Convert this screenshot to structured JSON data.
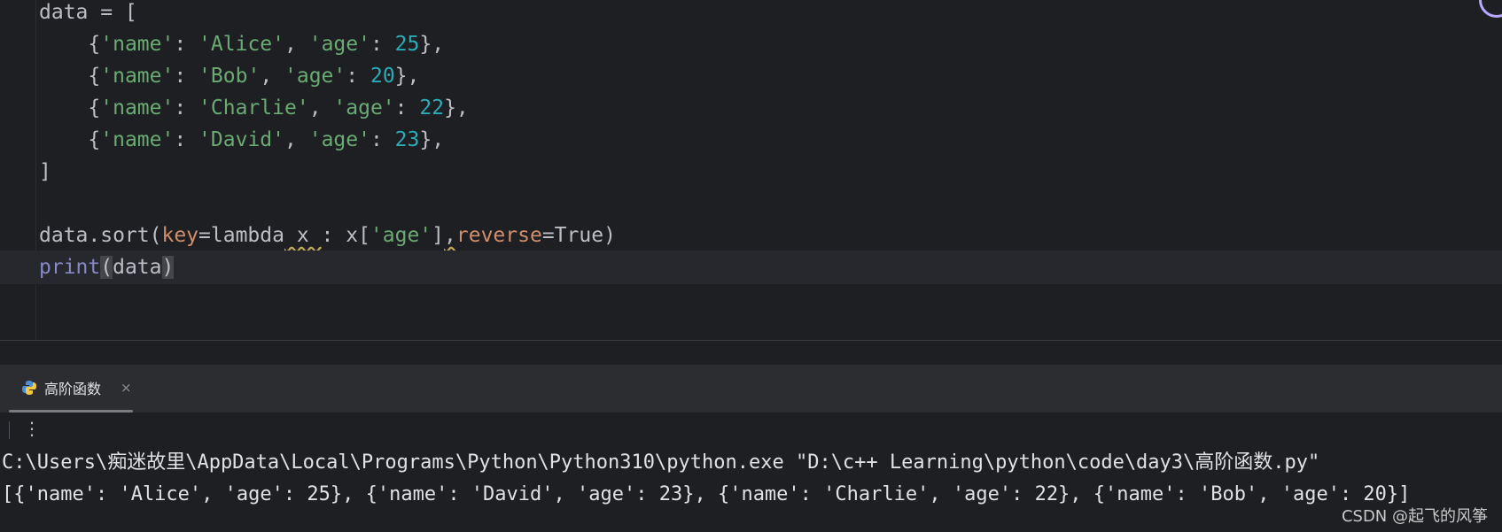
{
  "editor": {
    "line1": "data = [",
    "items": [
      {
        "name": "Alice",
        "age": "25"
      },
      {
        "name": "Bob",
        "age": "20"
      },
      {
        "name": "Charlie",
        "age": "22"
      },
      {
        "name": "David",
        "age": "23"
      }
    ],
    "close_bracket": "]",
    "sort_line": {
      "prefix": "data.sort(",
      "key": "key",
      "eq1": "=",
      "lambda": "lambda",
      "var": " x ",
      "colon": ": x[",
      "str_age": "'age'",
      "close": "]",
      "comma": ",",
      "reverse": "reverse",
      "eq2": "=True)"
    },
    "print_line": {
      "func": "print",
      "open": "(",
      "arg": "data",
      "close": ")"
    }
  },
  "run_panel": {
    "tab_label": "高阶函数",
    "close_glyph": "×",
    "more_glyph": "⋮"
  },
  "console": {
    "command": "C:\\Users\\痴迷故里\\AppData\\Local\\Programs\\Python\\Python310\\python.exe \"D:\\c++ Learning\\python\\code\\day3\\高阶函数.py\"",
    "output": "[{'name': 'Alice', 'age': 25}, {'name': 'David', 'age': 23}, {'name': 'Charlie', 'age': 22}, {'name': 'Bob', 'age': 20}]"
  },
  "watermark": "CSDN @起飞的风筝",
  "colors": {
    "background": "#1e1f22",
    "string": "#6aab73",
    "number": "#2aacb8",
    "keyword": "#cf8e6d",
    "builtin": "#8888c6"
  }
}
